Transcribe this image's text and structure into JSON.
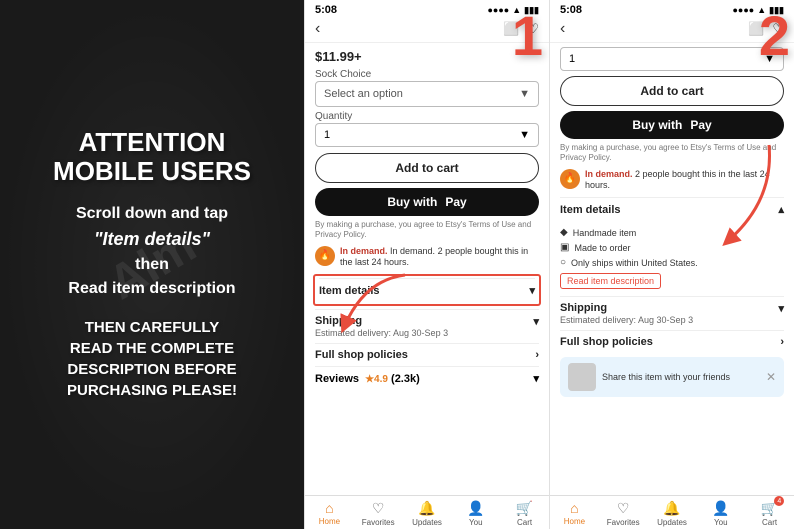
{
  "left": {
    "title": "ATTENTION\nMOBILE USERS",
    "instruction_1": "Scroll down and tap",
    "instruction_2": "\"Item details\"",
    "instruction_3": "then",
    "instruction_4": "Read item description",
    "footer": "THEN CAREFULLY\nREAD THE COMPLETE\nDESCRIPTION BEFORE\nPURCHASING PLEASE!"
  },
  "phone1": {
    "status_time": "5:08",
    "price": "$11.99+",
    "sock_choice_label": "Sock Choice",
    "select_placeholder": "Select an option",
    "quantity_label": "Quantity",
    "quantity_value": "1",
    "add_to_cart": "Add to cart",
    "buy_with": "Buy with",
    "pay_label": "Pay",
    "terms": "By making a purchase, you agree to Etsy's Terms of Use and Privacy Policy.",
    "demand_text": "In demand. 2 people bought this in the last 24 hours.",
    "item_details_label": "Item details",
    "shipping_label": "Shipping",
    "shipping_sub": "Estimated delivery: Aug 30-Sep 3",
    "policies_label": "Full shop policies",
    "reviews_label": "Reviews",
    "reviews_rating": "★4.9",
    "reviews_count": "(2.3k)",
    "tab_home": "Home",
    "tab_favorites": "Favorites",
    "tab_updates": "Updates",
    "tab_you": "You",
    "tab_cart": "Cart"
  },
  "phone2": {
    "status_time": "5:08",
    "quantity_value": "1",
    "add_to_cart": "Add to cart",
    "buy_with": "Buy with",
    "pay_label": "Pay",
    "terms": "By making a purchase, you agree to Etsy's Terms of Use and Privacy Policy.",
    "demand_text": "In demand. 2 people bought this in the last 24 hours.",
    "item_details_label": "Item details",
    "detail_1": "Handmade item",
    "detail_2": "Made to order",
    "detail_3": "Only ships within United States.",
    "read_desc": "Read item description",
    "shipping_label": "Shipping",
    "shipping_sub": "Estimated delivery: Aug 30-Sep 3",
    "policies_label": "Full shop policies",
    "share_text": "Share this item with your friends",
    "tab_home": "Home",
    "tab_favorites": "Favorites",
    "tab_updates": "Updates",
    "tab_you": "You",
    "tab_cart": "Cart",
    "cart_badge": "4"
  }
}
